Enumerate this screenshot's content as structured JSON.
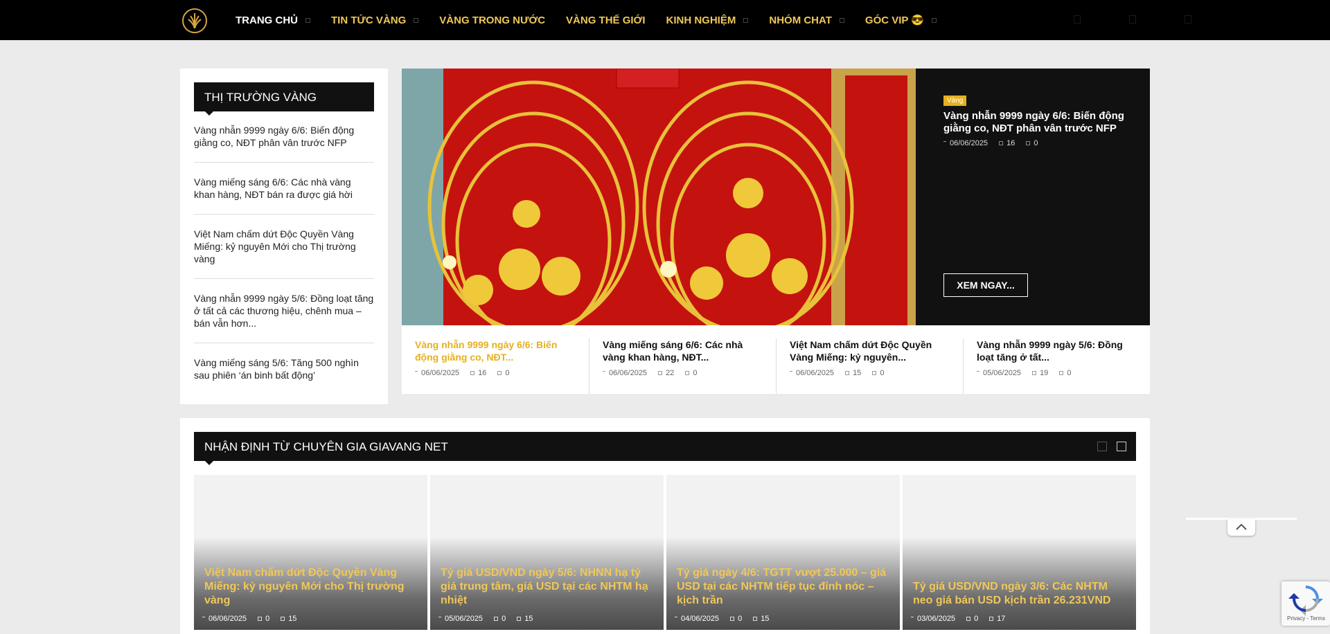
{
  "nav": {
    "items": [
      {
        "label": "TRANG CHỦ",
        "caret": true,
        "color": "home"
      },
      {
        "label": "TIN TỨC VÀNG",
        "caret": true,
        "color": "gold"
      },
      {
        "label": "VÀNG TRONG NƯỚC",
        "caret": false,
        "color": "gold"
      },
      {
        "label": "VÀNG THẾ GIỚI",
        "caret": false,
        "color": "gold"
      },
      {
        "label": "KINH NGHIỆM",
        "caret": true,
        "color": "gold"
      },
      {
        "label": "NHÓM CHAT",
        "caret": true,
        "color": "gold"
      },
      {
        "label": "GÓC VIP 😎",
        "caret": true,
        "color": "gold"
      }
    ]
  },
  "sidebar": {
    "title": "THỊ TRƯỜNG VÀNG",
    "items": [
      "Vàng nhẫn 9999 ngày 6/6: Biến động giằng co, NĐT phân vân trước NFP",
      "Vàng miếng sáng 6/6: Các nhà vàng khan hàng, NĐT bán ra được giá hời",
      "Việt Nam chấm dứt Độc Quyền Vàng Miếng: kỷ nguyên Mới cho Thị trường vàng",
      "Vàng nhẫn 9999 ngày 5/6: Đồng loạt tăng ở tất cả các thương hiệu, chênh mua – bán vẫn hơn...",
      "Vàng miếng sáng 5/6: Tăng 500 nghìn sau phiên ‘án binh bất động’"
    ]
  },
  "featured": {
    "category": "Vàng",
    "title": "Vàng nhẫn 9999 ngày 6/6: Biến động giằng co, NĐT phân vân trước NFP",
    "date": "06/06/2025",
    "views": "16",
    "comments": "0",
    "button": "XEM NGAY...",
    "thumbs": [
      {
        "title": "Vàng nhẫn 9999 ngày 6/6: Biến động giằng co, NĐT...",
        "date": "06/06/2025",
        "views": "16",
        "comments": "0"
      },
      {
        "title": "Vàng miếng sáng 6/6: Các nhà vàng khan hàng, NĐT...",
        "date": "06/06/2025",
        "views": "22",
        "comments": "0"
      },
      {
        "title": "Việt Nam chấm dứt Độc Quyền Vàng Miếng: kỷ nguyên...",
        "date": "06/06/2025",
        "views": "15",
        "comments": "0"
      },
      {
        "title": "Vàng nhẫn 9999 ngày 5/6: Đồng loạt tăng ở tất...",
        "date": "05/06/2025",
        "views": "19",
        "comments": "0"
      }
    ]
  },
  "expert": {
    "title": "NHẬN ĐỊNH TỪ CHUYÊN GIA GIAVANG NET",
    "cards": [
      {
        "title": "Việt Nam chấm dứt Độc Quyền Vàng Miếng: kỷ nguyên Mới cho Thị trường vàng",
        "date": "06/06/2025",
        "comments": "0",
        "views": "15"
      },
      {
        "title": "Tỷ giá USD/VND ngày 5/6: NHNN hạ tỷ giá trung tâm, giá USD tại các NHTM hạ nhiệt",
        "date": "05/06/2025",
        "comments": "0",
        "views": "15"
      },
      {
        "title": "Tỷ giá ngày 4/6: TGTT vượt 25.000 – giá USD tại các NHTM tiếp tục đỉnh nóc – kịch trần",
        "date": "04/06/2025",
        "comments": "0",
        "views": "15"
      },
      {
        "title": "Tỷ giá USD/VND ngày 3/6: Các NHTM neo giá bán USD kịch trần 26.231VND",
        "date": "03/06/2025",
        "comments": "0",
        "views": "17"
      }
    ]
  },
  "recaptcha": {
    "links": "Privacy - Terms"
  },
  "colors": {
    "gold": "#f0c75a",
    "tag": "#e6b01e",
    "dark": "#111111"
  }
}
